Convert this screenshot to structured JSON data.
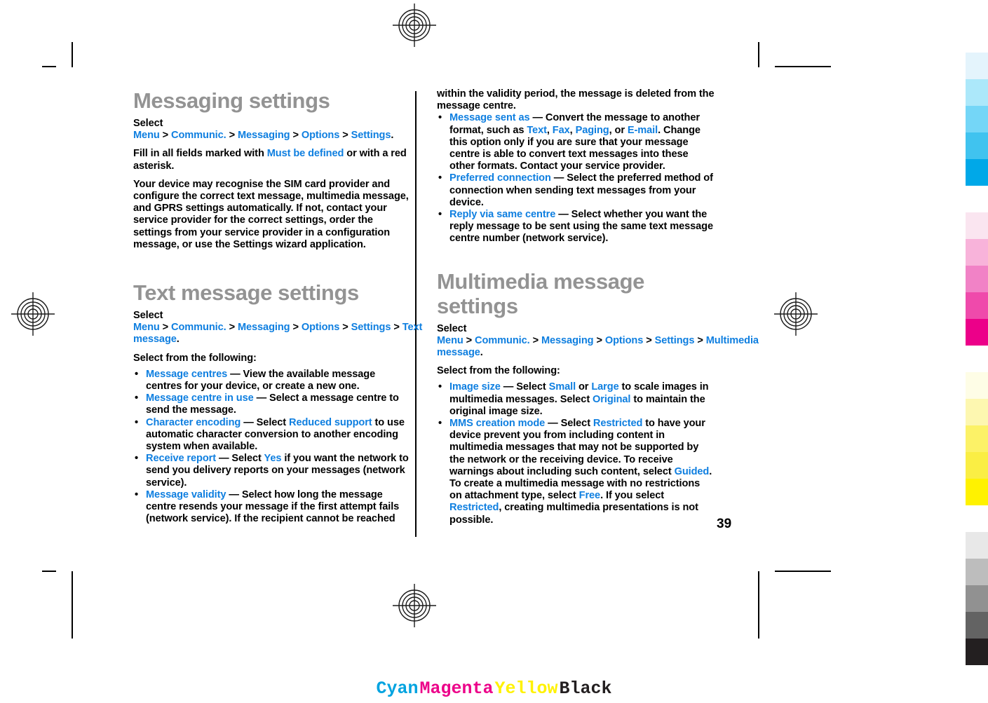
{
  "document": {
    "page_number": "39",
    "cmyk_label": [
      {
        "text": "Cyan",
        "color": "#00a3e0",
        "name": "cyan"
      },
      {
        "text": "Magenta",
        "color": "#ec0089",
        "name": "magenta"
      },
      {
        "text": "Yellow",
        "color": "#fff200",
        "name": "yellow"
      },
      {
        "text": "Black",
        "color": "#231f20",
        "name": "black"
      }
    ]
  },
  "left_column": {
    "heading1": "Messaging settings",
    "path1_prefix": "Select ",
    "path1": [
      "Menu",
      "Communic.",
      "Messaging",
      "Options",
      "Settings"
    ],
    "para_fill_1": "Fill in all fields marked with ",
    "para_fill_kw": "Must be defined",
    "para_fill_2": " or with a red asterisk.",
    "para_recognise": "Your device may recognise the SIM card provider and configure the correct text message, multimedia message, and GPRS settings automatically. If not, contact your service provider for the correct settings, order the settings from your service provider in a configuration message, or use the Settings wizard application.",
    "heading2": "Text message settings",
    "path2_prefix": "Select ",
    "path2": [
      "Menu",
      "Communic.",
      "Messaging",
      "Options",
      "Settings",
      "Text message"
    ],
    "select_following": "Select from the following:",
    "bullets": [
      {
        "term": "Message centres",
        "dash": " — ",
        "body_before": "View the available message centres for your device, or create a new one.",
        "body_kw": "",
        "body_after": ""
      },
      {
        "term": "Message centre in use",
        "dash": " — ",
        "body_before": "Select a message centre to send the message.",
        "body_kw": "",
        "body_after": ""
      },
      {
        "term": "Character encoding",
        "dash": " — ",
        "body_before": "Select ",
        "body_kw": "Reduced support",
        "body_after": " to use automatic character conversion to another encoding system when available."
      },
      {
        "term": "Receive report",
        "dash": " — ",
        "body_before": "Select ",
        "body_kw": "Yes",
        "body_after": " if you want the network to send you delivery reports on your messages (network service)."
      },
      {
        "term": "Message validity",
        "dash": " — ",
        "body_before": "Select how long the message centre resends your message if the first attempt fails (network service). If the recipient cannot be reached",
        "body_kw": "",
        "body_after": ""
      }
    ]
  },
  "right_column": {
    "continuation": "within the validity period, the message is deleted from the message centre.",
    "bullets_text": [
      {
        "term": "Message sent as",
        "dash": " — ",
        "seg1": "Convert the message to another format, such as ",
        "kw1": "Text",
        "seg2": ", ",
        "kw2": "Fax",
        "seg3": ", ",
        "kw3": "Paging",
        "seg4": ", or ",
        "kw4": "E-mail",
        "seg5": ". Change this option only if you are sure that your message centre is able to convert text messages into these other formats. Contact your service provider."
      },
      {
        "term": "Preferred connection ",
        "dash": " — ",
        "seg1": "Select the preferred method of connection when sending text messages from your device."
      },
      {
        "term": "Reply via same centre",
        "dash": " — ",
        "seg1": "Select whether you want the reply message to be sent using the same text message centre number (network service)."
      }
    ],
    "heading_mms": "Multimedia message settings",
    "path3_prefix": "Select ",
    "path3": [
      "Menu",
      "Communic.",
      "Messaging",
      "Options",
      "Settings",
      "Multimedia message"
    ],
    "select_following": "Select from the following:",
    "bullets_mms": [
      {
        "term": "Image size",
        "dash": " — ",
        "s1": "Select ",
        "k1": "Small",
        "s2": " or ",
        "k2": "Large",
        "s3": " to scale images in multimedia messages. Select ",
        "k3": "Original",
        "s4": " to maintain the original image size."
      },
      {
        "term": "MMS creation mode",
        "dash": " — ",
        "s1": "Select ",
        "k1": "Restricted",
        "s2": " to have your device prevent you from including content in multimedia messages that may not be supported by the network or the receiving device. To receive warnings about including such content, select ",
        "k2": "Guided",
        "s3": ". To create a multimedia message with no restrictions on attachment type, select ",
        "k3": "Free",
        "s4": ". If you select ",
        "k4": "Restricted",
        "s5": ", creating multimedia presentations is not possible."
      }
    ]
  },
  "color_bar": {
    "swatches": [
      "#e4f4fc",
      "#ace8fa",
      "#74d6f7",
      "#40c3ef",
      "#00a8e8",
      "GAP",
      "#fae5f0",
      "#f8b3da",
      "#f182c6",
      "#ef4aab",
      "#ec0089",
      "GAP",
      "#fefde6",
      "#fdf7b0",
      "#fcf267",
      "#faee44",
      "#fff200",
      "GAP",
      "#e8e8e8",
      "#bdbdbd",
      "#919191",
      "#636363",
      "#231f20"
    ]
  }
}
